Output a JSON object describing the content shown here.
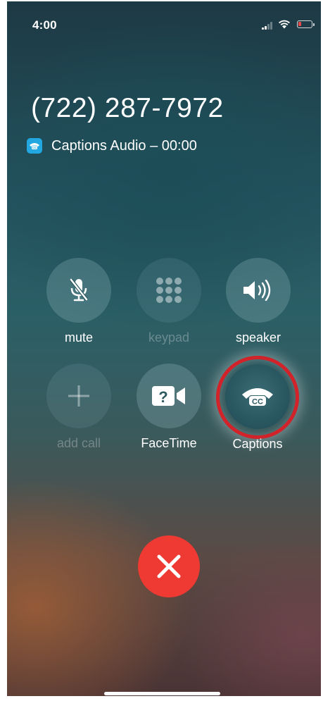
{
  "status_bar": {
    "time": "4:00"
  },
  "call": {
    "number": "(722) 287-7972",
    "status": "Captions Audio – 00:00"
  },
  "controls": {
    "mute": "mute",
    "keypad": "keypad",
    "speaker": "speaker",
    "add_call": "add call",
    "facetime": "FaceTime",
    "captions": "Captions"
  },
  "icons": {
    "mute": "mic-slash-icon",
    "keypad": "keypad-icon",
    "speaker": "speaker-icon",
    "add_call": "plus-icon",
    "facetime": "facetime-camera-icon",
    "captions": "cc-phone-icon",
    "end_call": "close-icon",
    "app_badge": "captions-app-icon"
  },
  "colors": {
    "end_call": "#ee3a32",
    "highlight_ring": "#d2232a",
    "app_badge": "#22a7e0",
    "battery_low": "#e84a4a"
  }
}
